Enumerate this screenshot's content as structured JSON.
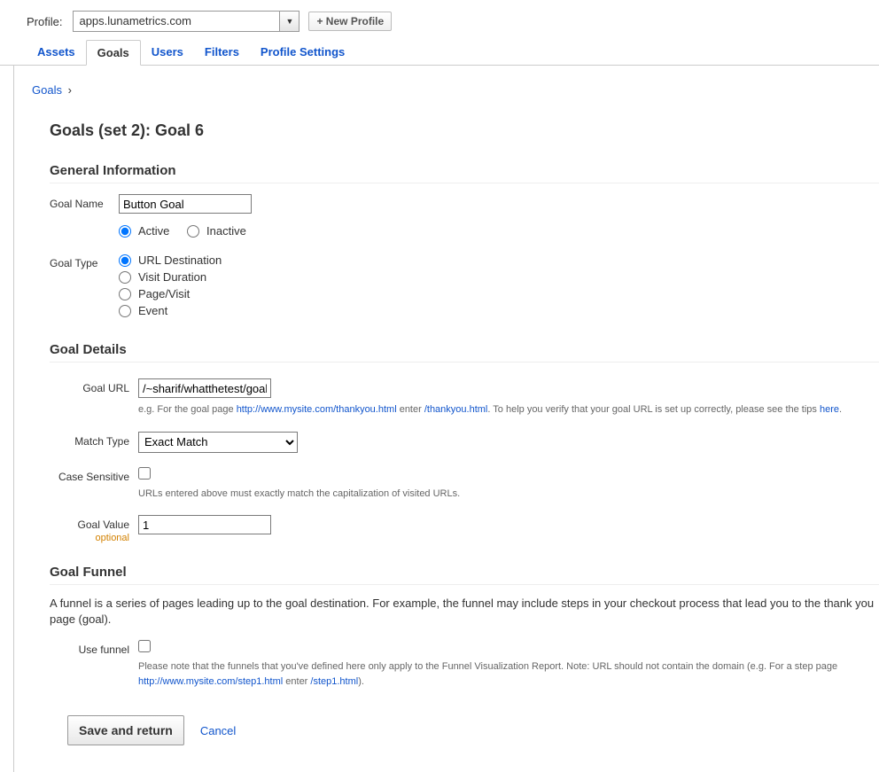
{
  "header": {
    "profile_label": "Profile:",
    "profile_value": "apps.lunametrics.com",
    "new_profile": "+ New Profile"
  },
  "tabs": [
    "Assets",
    "Goals",
    "Users",
    "Filters",
    "Profile Settings"
  ],
  "active_tab": "Goals",
  "breadcrumb": {
    "root": "Goals"
  },
  "page_title": "Goals (set 2): Goal 6",
  "sections": {
    "general": {
      "title": "General Information",
      "goal_name_label": "Goal Name",
      "goal_name_value": "Button Goal",
      "status": {
        "active": "Active",
        "inactive": "Inactive"
      },
      "goal_type_label": "Goal Type",
      "types": {
        "url": "URL Destination",
        "visit": "Visit Duration",
        "page": "Page/Visit",
        "event": "Event"
      }
    },
    "details": {
      "title": "Goal Details",
      "goal_url_label": "Goal URL",
      "goal_url_value": "/~sharif/whatthetest/goalp",
      "url_help_pre": "e.g. For the goal page ",
      "url_help_link1": "http://www.mysite.com/thankyou.html",
      "url_help_mid": " enter ",
      "url_help_slash": "/thankyou.html",
      "url_help_post": ". To help you verify that your goal URL is set up correctly, please see the tips ",
      "url_help_here": "here",
      "url_help_dot": ".",
      "match_type_label": "Match Type",
      "match_type_value": "Exact Match",
      "case_label": "Case Sensitive",
      "case_help": "URLs entered above must exactly match the capitalization of visited URLs.",
      "value_label": "Goal Value",
      "value_optional": "optional",
      "value_input": "1"
    },
    "funnel": {
      "title": "Goal Funnel",
      "description": "A funnel is a series of pages leading up to the goal destination. For example, the funnel may include steps in your checkout process that lead you to the thank you page (goal).",
      "use_label": "Use funnel",
      "help_pre": "Please note that the funnels that you've defined here only apply to the Funnel Visualization Report. Note: URL should not contain the domain (e.g. For a step page ",
      "help_link": "http://www.mysite.com/step1.html",
      "help_mid": " enter ",
      "help_slash": "/step1.html",
      "help_post": ")."
    }
  },
  "footer": {
    "save": "Save and return",
    "cancel": "Cancel"
  }
}
